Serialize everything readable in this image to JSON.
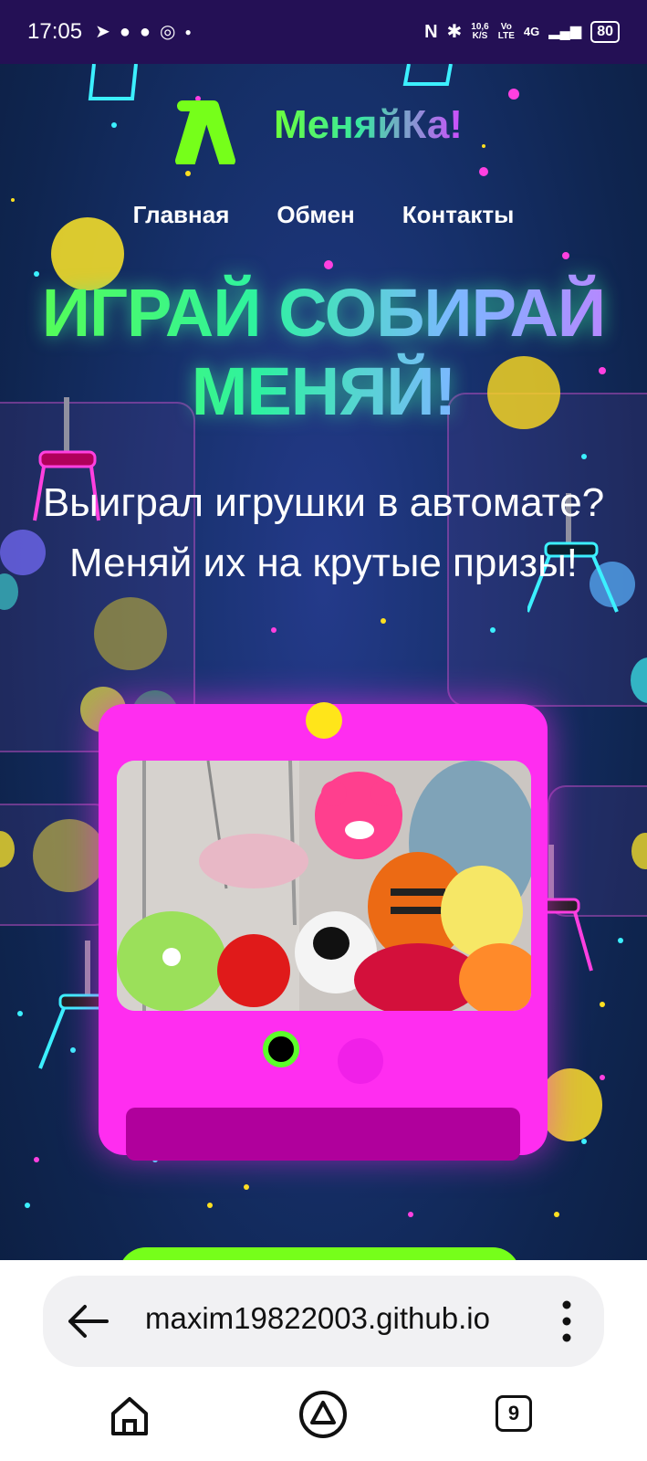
{
  "status_bar": {
    "time": "17:05",
    "left_icons": [
      "telegram-icon",
      "chat-icon",
      "message-icon",
      "whatsapp-icon",
      "dot-icon"
    ],
    "speed_value": "10,6",
    "speed_unit": "K/S",
    "volte_top": "Vo",
    "volte_bottom": "LTE",
    "network": "4G",
    "battery": "80"
  },
  "site": {
    "logo_text": "МеняйКа!",
    "nav": [
      "Главная",
      "Обмен",
      "Контакты"
    ],
    "hero_title_line1": "ИГРАЙ СОБИРАЙ",
    "hero_title_line2": "МЕНЯЙ!",
    "hero_sub_line1": "Выиграл игрушки в автомате?",
    "hero_sub_line2": "Меняй их на крутые призы!"
  },
  "browser": {
    "url": "maxim19822003.github.io",
    "tab_count": "9"
  },
  "colors": {
    "accent_green": "#76ff1a",
    "accent_magenta": "#ff2df0",
    "status_bar": "#241055"
  }
}
